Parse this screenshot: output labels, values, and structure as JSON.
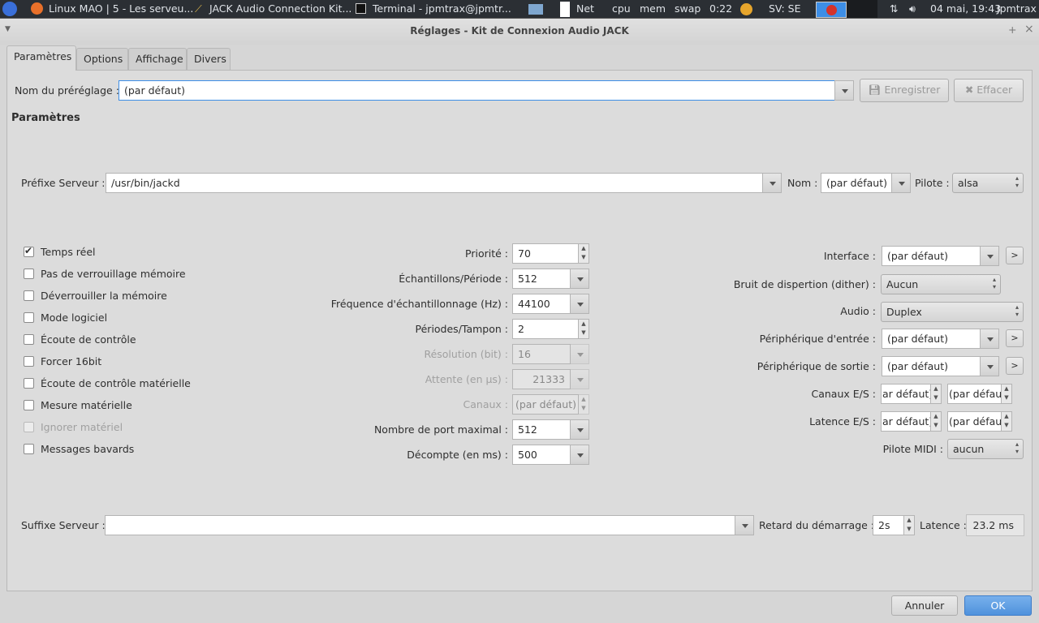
{
  "taskbar": {
    "windows": [
      "Linux MAO | 5 - Les serveu...",
      "JACK Audio Connection Kit...",
      "Terminal - jpmtrax@jpmtr..."
    ],
    "net": "Net",
    "cpu": "cpu",
    "mem": "mem",
    "swap": "swap",
    "uptime": "0:22",
    "sv": "SV: SE",
    "clock": "04 mai, 19:43",
    "user": "Jpmtrax"
  },
  "window": {
    "title": "Réglages - Kit de Connexion Audio JACK",
    "pin": "+",
    "close": "×"
  },
  "tabs": [
    "Paramètres",
    "Options",
    "Affichage",
    "Divers"
  ],
  "preset": {
    "label": "Nom du préréglage :",
    "value": "(par défaut)",
    "save": "Enregistrer",
    "delete": "Effacer"
  },
  "section_title": "Paramètres",
  "server": {
    "prefix_label": "Préfixe Serveur :",
    "prefix_value": "/usr/bin/jackd",
    "name_label": "Nom :",
    "name_value": "(par défaut)",
    "driver_label": "Pilote :",
    "driver_value": "alsa"
  },
  "checkboxes": [
    {
      "label": "Temps réel",
      "checked": true,
      "disabled": false
    },
    {
      "label": "Pas de verrouillage mémoire",
      "checked": false,
      "disabled": false
    },
    {
      "label": "Déverrouiller la mémoire",
      "checked": false,
      "disabled": false
    },
    {
      "label": "Mode logiciel",
      "checked": false,
      "disabled": false
    },
    {
      "label": "Écoute de contrôle",
      "checked": false,
      "disabled": false
    },
    {
      "label": "Forcer 16bit",
      "checked": false,
      "disabled": false
    },
    {
      "label": "Écoute de contrôle matérielle",
      "checked": false,
      "disabled": false
    },
    {
      "label": "Mesure matérielle",
      "checked": false,
      "disabled": false
    },
    {
      "label": "Ignorer matériel",
      "checked": false,
      "disabled": true
    },
    {
      "label": "Messages bavards",
      "checked": false,
      "disabled": false
    }
  ],
  "middle": [
    {
      "label": "Priorité :",
      "value": "70",
      "kind": "spin"
    },
    {
      "label": "Échantillons/Période :",
      "value": "512",
      "kind": "combo"
    },
    {
      "label": "Fréquence d'échantillonnage (Hz) :",
      "value": "44100",
      "kind": "combo"
    },
    {
      "label": "Périodes/Tampon :",
      "value": "2",
      "kind": "spin"
    },
    {
      "label": "Résolution (bit) :",
      "value": "16",
      "kind": "combo",
      "disabled": true
    },
    {
      "label": "Attente (en µs) :",
      "value": "21333",
      "kind": "combo",
      "disabled": true
    },
    {
      "label": "Canaux :",
      "value": "(par défaut)",
      "kind": "spin",
      "disabled": true
    },
    {
      "label": "Nombre de port maximal :",
      "value": "512",
      "kind": "combo"
    },
    {
      "label": "Décompte (en ms) :",
      "value": "500",
      "kind": "combo"
    }
  ],
  "right": {
    "interface_label": "Interface :",
    "interface_value": "(par défaut)",
    "dither_label": "Bruit de dispertion (dither) :",
    "dither_value": "Aucun",
    "audio_label": "Audio :",
    "audio_value": "Duplex",
    "input_label": "Périphérique d'entrée :",
    "input_value": "(par défaut)",
    "output_label": "Périphérique de sortie :",
    "output_value": "(par défaut)",
    "channels_label": "Canaux E/S :",
    "channels_in": "ar défaut)",
    "channels_out": "(par défaut)",
    "latency_label": "Latence E/S :",
    "latency_in": "ar défaut)",
    "latency_out": "(par défaut)",
    "midi_label": "Pilote MIDI :",
    "midi_value": "aucun",
    "more": ">"
  },
  "bottom": {
    "suffix_label": "Suffixe Serveur :",
    "suffix_value": "",
    "delay_label": "Retard du démarrage :",
    "delay_value": "2s",
    "latency_label": "Latence :",
    "latency_value": "23.2 ms"
  },
  "buttons": {
    "cancel": "Annuler",
    "ok": "OK"
  }
}
